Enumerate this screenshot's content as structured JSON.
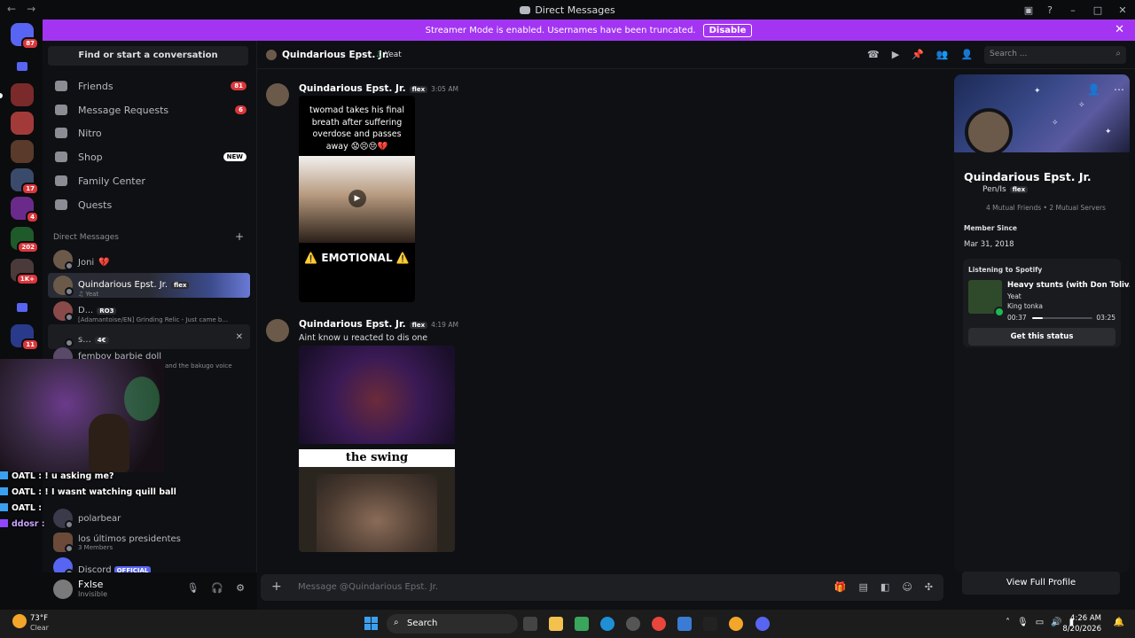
{
  "window": {
    "title": "Direct Messages"
  },
  "banner": {
    "text": "Streamer Mode is enabled. Usernames have been truncated.",
    "disable_label": "Disable"
  },
  "rail": {
    "badges": [
      "87",
      "17",
      "4",
      "202",
      "1K+",
      "11"
    ]
  },
  "sidebar": {
    "find_label": "Find or start a conversation",
    "nav": [
      {
        "label": "Friends",
        "badge": "81"
      },
      {
        "label": "Message Requests",
        "badge": "6"
      },
      {
        "label": "Nitro"
      },
      {
        "label": "Shop",
        "badge": "NEW"
      },
      {
        "label": "Family Center"
      },
      {
        "label": "Quests"
      }
    ],
    "dm_header": "Direct Messages",
    "dms": [
      {
        "name": "Joni",
        "emoji": "💔"
      },
      {
        "name": "Quindarious Epst. Jr.",
        "tag": "flex",
        "sub": "Yeat"
      },
      {
        "name": "D...",
        "tag": "RO3",
        "sub": "[Adamantoise/EN] Grinding Relic - Just came b..."
      },
      {
        "name": "s...",
        "tag": "4€"
      },
      {
        "name": "femboy barbie doll",
        "sub": "and the bakugo voice"
      },
      {
        "name": "polarbear"
      },
      {
        "name": "los últimos presidentes",
        "sub": "3 Members"
      },
      {
        "name": "Discord",
        "tag": "OFFICIAL"
      }
    ]
  },
  "overlay_chat": [
    {
      "text": "OATL : ! u asking me?"
    },
    {
      "text": "OATL : ! I wasnt watching quill ball"
    },
    {
      "text": "OATL :"
    },
    {
      "text": "ddosr :"
    }
  ],
  "user": {
    "name": "Fxlse",
    "status": "Invisible"
  },
  "header": {
    "name": "Quindarious Epst. Jr.",
    "activity": "Yeat",
    "search_placeholder": "Search ..."
  },
  "messages": [
    {
      "author": "Quindarious Epst. Jr.",
      "tag": "flex",
      "time": "3:05 AM",
      "video_caption": "twomad takes his final breath after suffering overdose and passes away 😟😣😔💔",
      "video_footer": "⚠️ EMOTIONAL ⚠️"
    },
    {
      "author": "Quindarious Epst. Jr.",
      "tag": "flex",
      "time": "4:19 AM",
      "text": "Aint know u reacted to dis one",
      "image_caption": "the swing"
    }
  ],
  "composer": {
    "placeholder": "Message @Quindarious Epst. Jr."
  },
  "profile": {
    "name": "Quindarious Epst. Jr.",
    "pronouns": "Pen/Is",
    "tag": "flex",
    "mutual_friends": "4 Mutual Friends",
    "mutual_servers": "2 Mutual Servers",
    "member_since_label": "Member Since",
    "member_since": "Mar 31, 2018",
    "spotify": {
      "header": "Listening to Spotify",
      "song": "Heavy stunts (with Don Toliv...",
      "artist": "Yeat",
      "album": "King tonka",
      "elapsed": "00:37",
      "total": "03:25",
      "progress": 0.18,
      "button": "Get this status"
    },
    "view_full": "View Full Profile"
  },
  "taskbar": {
    "temp": "73°F",
    "condition": "Clear",
    "search": "Search",
    "time": "4:26 AM",
    "date": "8/20/2026"
  },
  "colors": {
    "accent": "#5865f2",
    "banner": "#a335f2",
    "danger": "#da373c",
    "spotify": "#1db954"
  }
}
